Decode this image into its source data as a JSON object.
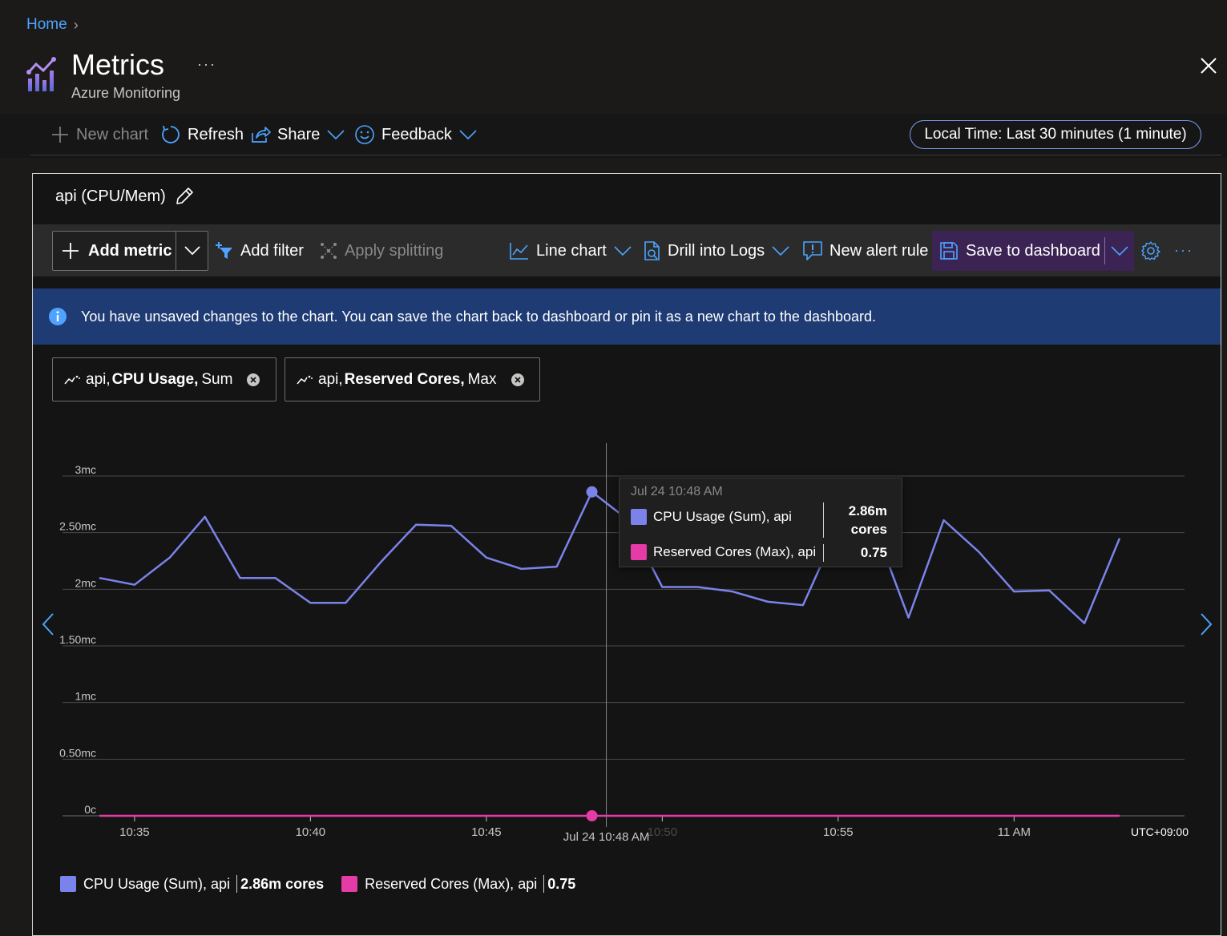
{
  "breadcrumb": {
    "home": "Home"
  },
  "header": {
    "title": "Metrics",
    "subtitle": "Azure Monitoring",
    "more": "···"
  },
  "toolbar": {
    "new_chart": "New chart",
    "refresh": "Refresh",
    "share": "Share",
    "feedback": "Feedback",
    "time_range": "Local Time: Last 30 minutes (1 minute)"
  },
  "chart_card": {
    "title": "api (CPU/Mem)",
    "toolbar": {
      "add_metric": "Add metric",
      "add_filter": "Add filter",
      "apply_splitting": "Apply splitting",
      "line_chart": "Line chart",
      "drill_into_logs": "Drill into Logs",
      "new_alert_rule": "New alert rule",
      "save_to_dashboard": "Save to dashboard",
      "more": "···"
    },
    "info_message": "You have unsaved changes to the chart. You can save the chart back to dashboard or pin it as a new chart to the dashboard.",
    "metric_pills": [
      {
        "resource": "api,",
        "metric": "CPU Usage,",
        "agg": "Sum"
      },
      {
        "resource": "api,",
        "metric": "Reserved Cores,",
        "agg": "Max"
      }
    ],
    "tooltip": {
      "time": "Jul 24 10:48 AM",
      "rows": [
        {
          "label": "CPU Usage (Sum), api",
          "value_line1": "2.86m",
          "value_line2": "cores"
        },
        {
          "label": "Reserved Cores (Max), api",
          "value": "0.75"
        }
      ]
    },
    "legend": [
      {
        "label": "CPU Usage (Sum), api",
        "value": "2.86m cores",
        "color": "#7b83eb"
      },
      {
        "label": "Reserved Cores (Max), api",
        "value": "0.75",
        "color": "#e43ba6"
      }
    ],
    "colors": {
      "cpu": "#7b83eb",
      "reserved": "#e43ba6",
      "accent_save": "#3b2354",
      "info_bg": "#1f3b74"
    }
  },
  "chart_data": {
    "type": "line",
    "x_ticks": [
      "10:35",
      "10:40",
      "10:45",
      "10:50",
      "10:55",
      "11 AM"
    ],
    "x_hover_label": "Jul 24 10:48 AM",
    "timezone_label": "UTC+09:00",
    "y_ticks": [
      "0c",
      "0.50mc",
      "1mc",
      "1.50mc",
      "2mc",
      "2.50mc",
      "3mc"
    ],
    "ylim": [
      0,
      3
    ],
    "x_minutes": [
      34,
      35,
      36,
      37,
      38,
      39,
      40,
      41,
      42,
      43,
      44,
      45,
      46,
      47,
      48,
      49,
      50,
      51,
      52,
      53,
      54,
      55,
      56,
      57,
      58,
      59,
      60,
      61,
      62,
      63
    ],
    "series": [
      {
        "name": "CPU Usage (Sum), api",
        "unit": "mc",
        "values": [
          2.1,
          2.04,
          2.28,
          2.64,
          2.1,
          2.1,
          1.88,
          1.88,
          2.24,
          2.57,
          2.56,
          2.28,
          2.18,
          2.2,
          2.86,
          2.62,
          2.02,
          2.02,
          1.98,
          1.89,
          1.86,
          2.55,
          2.58,
          1.75,
          2.61,
          2.33,
          1.98,
          1.99,
          1.7,
          2.45
        ]
      },
      {
        "name": "Reserved Cores (Max), api",
        "unit": "c",
        "values": [
          0.75,
          0.75,
          0.75,
          0.75,
          0.75,
          0.75,
          0.75,
          0.75,
          0.75,
          0.75,
          0.75,
          0.75,
          0.75,
          0.75,
          0.75,
          0.75,
          0.75,
          0.75,
          0.75,
          0.75,
          0.75,
          0.75,
          0.75,
          0.75,
          0.75,
          0.75,
          0.75,
          0.75,
          0.75,
          0.75
        ]
      }
    ],
    "hover_index": 14,
    "grid": true
  }
}
